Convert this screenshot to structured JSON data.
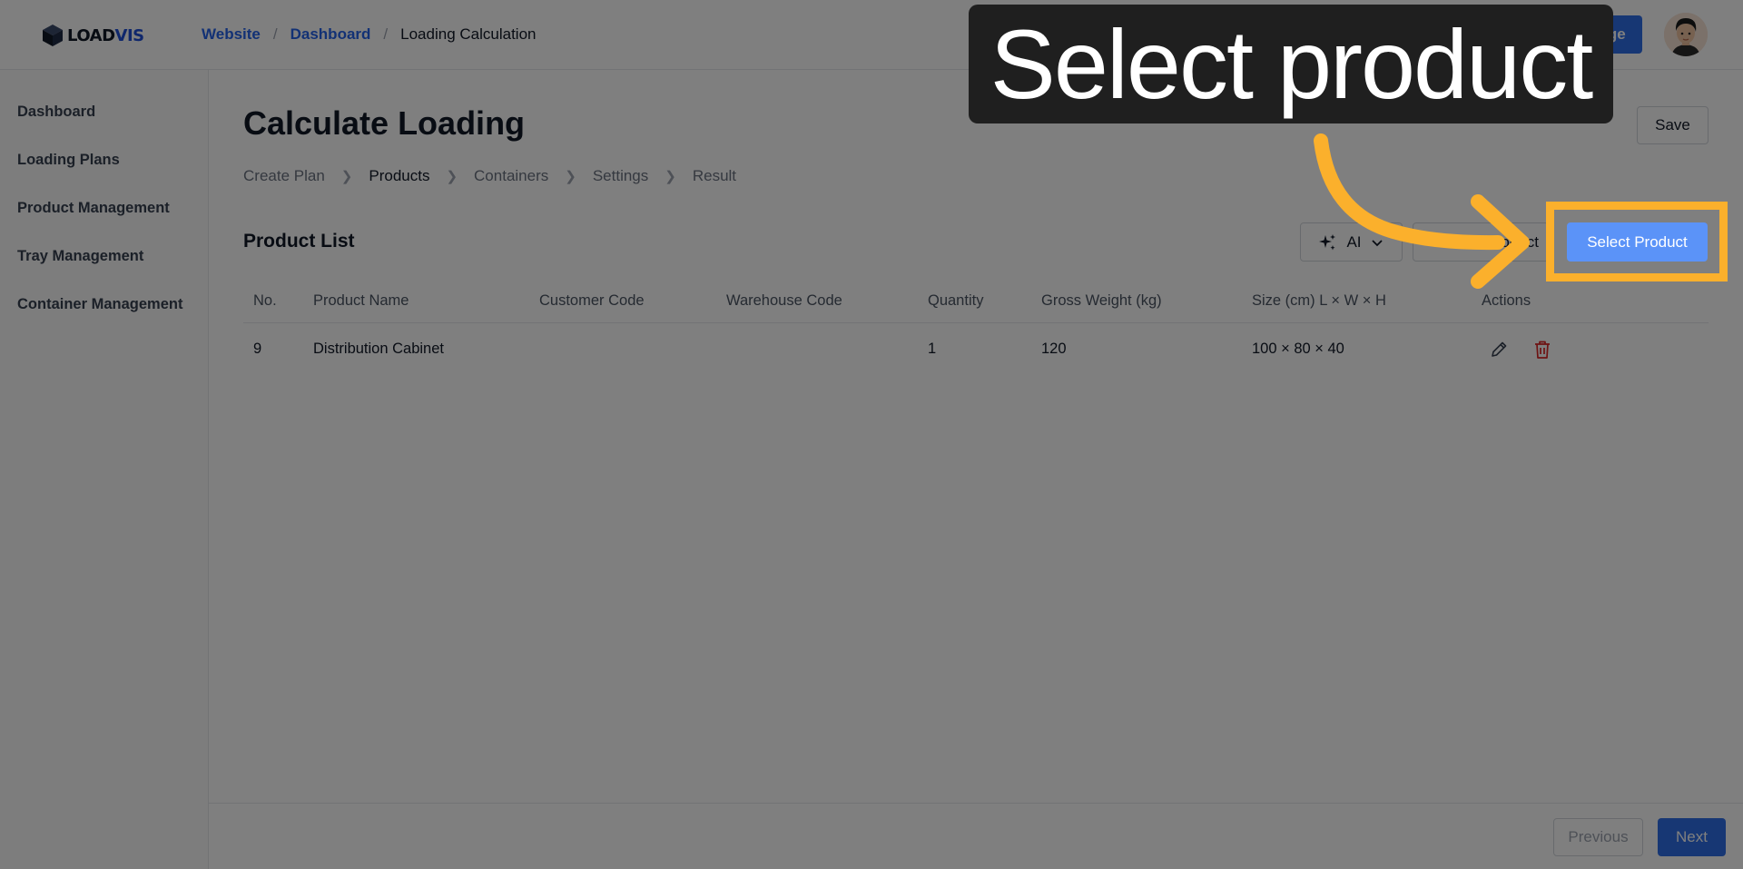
{
  "header": {
    "logo_text_a": "LOAD",
    "logo_text_b": "VIS",
    "breadcrumb": [
      "Website",
      "Dashboard",
      "Loading Calculation"
    ],
    "recharge_label": "Recharge"
  },
  "sidebar": {
    "items": [
      {
        "label": "Dashboard"
      },
      {
        "label": "Loading Plans"
      },
      {
        "label": "Product Management"
      },
      {
        "label": "Tray Management"
      },
      {
        "label": "Container Management"
      }
    ]
  },
  "main": {
    "title": "Calculate Loading",
    "save_label": "Save",
    "steps": [
      "Create Plan",
      "Products",
      "Containers",
      "Settings",
      "Result"
    ],
    "active_step": "Products",
    "section_title": "Product List",
    "ai_label": "AI",
    "add_label": "Add Product",
    "select_label": "Select Product",
    "columns": [
      "No.",
      "Product Name",
      "Customer Code",
      "Warehouse Code",
      "Quantity",
      "Gross Weight (kg)",
      "Size (cm) L × W × H",
      "Actions"
    ],
    "rows": [
      {
        "no": "9",
        "name": "Distribution Cabinet",
        "customer_code": "",
        "warehouse_code": "",
        "quantity": "1",
        "gross_weight": "120",
        "size": "100 × 80 × 40"
      }
    ]
  },
  "footer": {
    "previous_label": "Previous",
    "next_label": "Next"
  },
  "overlay": {
    "callout_text": "Select product",
    "accent_color": "#fbb02c"
  }
}
